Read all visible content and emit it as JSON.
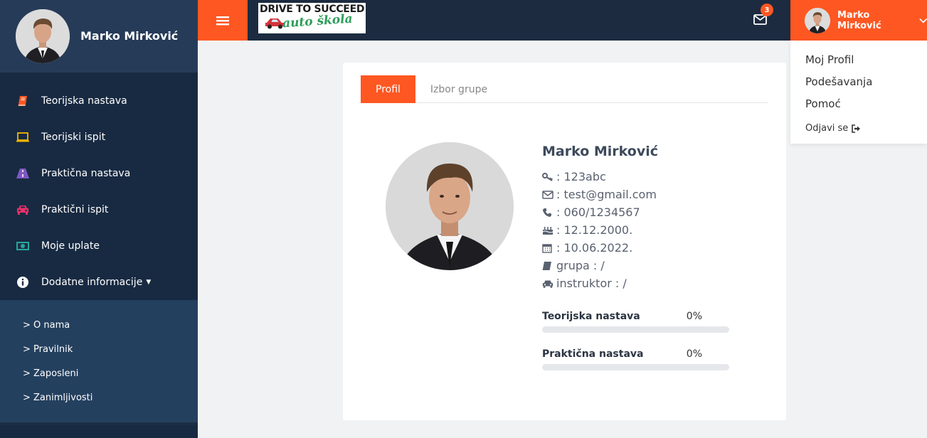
{
  "user": {
    "name": "Marko Mirković"
  },
  "sidebar": {
    "items": [
      {
        "label": "Teorijska nastava",
        "icon": "book-icon",
        "color": "#ff5722"
      },
      {
        "label": "Teorijski ispit",
        "icon": "laptop-icon",
        "color": "#f7b500"
      },
      {
        "label": "Praktična nastava",
        "icon": "road-icon",
        "color": "#7e57c2"
      },
      {
        "label": "Praktični ispit",
        "icon": "car-icon",
        "color": "#ec2f67"
      },
      {
        "label": "Moje uplate",
        "icon": "money-icon",
        "color": "#26a69a"
      },
      {
        "label": "Dodatne informacije",
        "icon": "info-icon",
        "color": "#ffffff"
      }
    ],
    "sub_items": [
      "> O nama",
      "> Pravilnik",
      "> Zaposleni",
      "> Zanimljivosti"
    ]
  },
  "topbar": {
    "logo_line1": "DRIVE TO SUCCEED",
    "logo_line2": "auto škola",
    "mail_count": "3",
    "accent": "#fe5722"
  },
  "dropdown": {
    "items": [
      "Moj Profil",
      "Podešavanja",
      "Pomoć"
    ],
    "logout": "Odjavi se"
  },
  "profile": {
    "tabs": [
      "Profil",
      "Izbor grupe"
    ],
    "fields": [
      {
        "icon": "key-icon",
        "text": ": 123abc"
      },
      {
        "icon": "envelope-icon",
        "text": ": test@gmail.com"
      },
      {
        "icon": "phone-icon",
        "text": ": 060/1234567"
      },
      {
        "icon": "birthday-cake-icon",
        "text": ": 12.12.2000."
      },
      {
        "icon": "calendar-icon",
        "text": ": 10.06.2022."
      },
      {
        "icon": "book-icon",
        "text": "grupa : /"
      },
      {
        "icon": "car-icon",
        "text": "instruktor : /"
      }
    ],
    "progress": [
      {
        "label": "Teorijska nastava",
        "value_text": "0%",
        "value": 0
      },
      {
        "label": "Praktična nastava",
        "value_text": "0%",
        "value": 0
      }
    ]
  }
}
